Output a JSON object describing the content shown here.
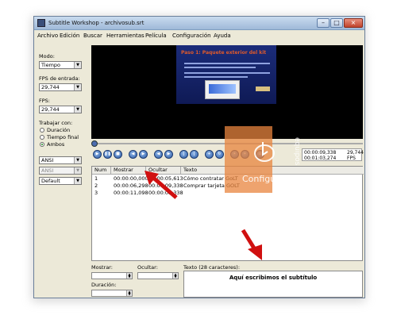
{
  "window": {
    "title": "Subtitle Workshop - archivosub.srt"
  },
  "menu": [
    "Archivo",
    "Edición",
    "Buscar",
    "Herramientas",
    "Película",
    "Configuración",
    "Ayuda"
  ],
  "left": {
    "mode_label": "Modo:",
    "mode_value": "Tiempo",
    "input_fps_label": "FPS de entrada:",
    "input_fps_value": "29,744",
    "fps_label": "FPS:",
    "fps_value": "29,744",
    "work_label": "Trabajar con:",
    "radios": [
      "Duración",
      "Tiempo final",
      "Ambos"
    ],
    "selected_radio": "Ambos",
    "charset1": "ANSI",
    "charset2": "ANSI",
    "style": "Default"
  },
  "video": {
    "slide_title": "Paso 1: Paquete exterior del kit"
  },
  "player": {
    "time_current": "00:00:09,338",
    "time_total": "00:01:03,274",
    "fps": "29,744",
    "fps_label": "FPS"
  },
  "table": {
    "headers": [
      "Num",
      "Mostrar",
      "Ocultar",
      "Texto"
    ],
    "rows": [
      {
        "num": "1",
        "show": "00:00:00,000",
        "hide": "00:00:05,613",
        "text": "Cómo contratar GoLT"
      },
      {
        "num": "2",
        "show": "00:00:06,298",
        "hide": "00:00:09,338",
        "text": "Comprar tarjeta GOLT"
      },
      {
        "num": "3",
        "show": "00:00:11,098",
        "hide": "00:00:09,338",
        "text": ""
      }
    ]
  },
  "editor": {
    "show_label": "Mostrar:",
    "hide_label": "Ocultar:",
    "duration_label": "Duración:",
    "text_label": "Texto (28 caracteres):",
    "text_value": "Aquí escribimos el subtítulo"
  },
  "watermark": {
    "main": "Configurar",
    "vertical": "equipos"
  }
}
